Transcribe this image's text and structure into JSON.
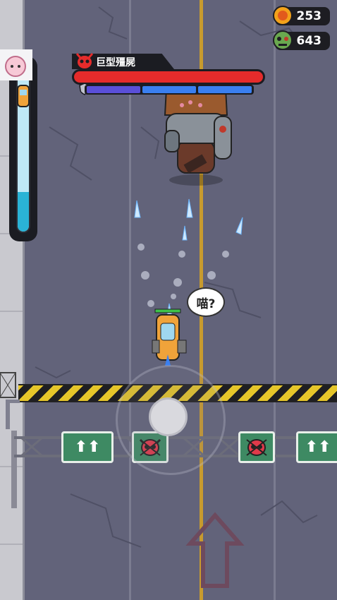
{
  "hud": {
    "coins": {
      "value": "253",
      "icon": "coin-icon",
      "color": "#f3a21a"
    },
    "zombie_kills": {
      "value": "643",
      "icon": "zombie-head-icon",
      "color": "#6aa84f"
    }
  },
  "level_progress": {
    "fill_fraction": 0.25,
    "marker_icon": "car-icon",
    "goal_icon": "character-portrait-icon"
  },
  "boss": {
    "name": "巨型殭屍",
    "hp_fraction": 1.0,
    "hp_color": "#e52b2b",
    "shield_segments": 3,
    "icon": "demon-skull-icon"
  },
  "speech_bubble": {
    "text": "喵?"
  },
  "lane_signs": [
    {
      "type": "arrows",
      "text": "⬆⬆"
    },
    {
      "type": "skull",
      "icon": "red-skull-sign-icon"
    },
    {
      "type": "skull",
      "icon": "red-skull-sign-icon"
    },
    {
      "type": "arrows",
      "text": "⬆⬆"
    }
  ],
  "colors": {
    "road": "#62637a",
    "center_line": "#c89b2e",
    "hazard_yellow": "#e6c62a",
    "sign_green": "#3e8a63"
  }
}
